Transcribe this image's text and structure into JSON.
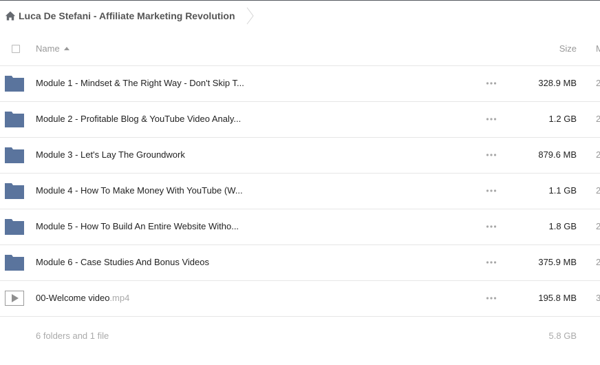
{
  "breadcrumb": {
    "home_icon": "home-icon",
    "current": "Luca De Stefani - Affiliate Marketing Revolution"
  },
  "header": {
    "name": "Name",
    "size": "Size",
    "modified": "M",
    "sort_icon": "sort-ascending-icon"
  },
  "colors": {
    "folder": "#5a749d",
    "text": "#222222",
    "muted": "#999999"
  },
  "files": [
    {
      "type": "folder",
      "icon": "folder-icon",
      "name": "Module 1 - Mindset & The Right Way - Don't Skip T...",
      "ext": "",
      "size": "328.9 MB",
      "modified": "2"
    },
    {
      "type": "folder",
      "icon": "folder-icon",
      "name": "Module 2 - Profitable Blog & YouTube Video Analy...",
      "ext": "",
      "size": "1.2 GB",
      "modified": "2"
    },
    {
      "type": "folder",
      "icon": "folder-icon",
      "name": "Module 3 - Let's Lay The Groundwork",
      "ext": "",
      "size": "879.6 MB",
      "modified": "2"
    },
    {
      "type": "folder",
      "icon": "folder-icon",
      "name": "Module 4 - How To Make Money With YouTube (W...",
      "ext": "",
      "size": "1.1 GB",
      "modified": "2"
    },
    {
      "type": "folder",
      "icon": "folder-icon",
      "name": "Module 5 - How To Build An Entire Website Witho...",
      "ext": "",
      "size": "1.8 GB",
      "modified": "2"
    },
    {
      "type": "folder",
      "icon": "folder-icon",
      "name": "Module 6 - Case Studies And Bonus Videos",
      "ext": "",
      "size": "375.9 MB",
      "modified": "2"
    },
    {
      "type": "video",
      "icon": "video-file-icon",
      "name": "00-Welcome video",
      "ext": ".mp4",
      "size": "195.8 MB",
      "modified": "3"
    }
  ],
  "summary": {
    "text": "6 folders and 1 file",
    "total_size": "5.8 GB"
  }
}
